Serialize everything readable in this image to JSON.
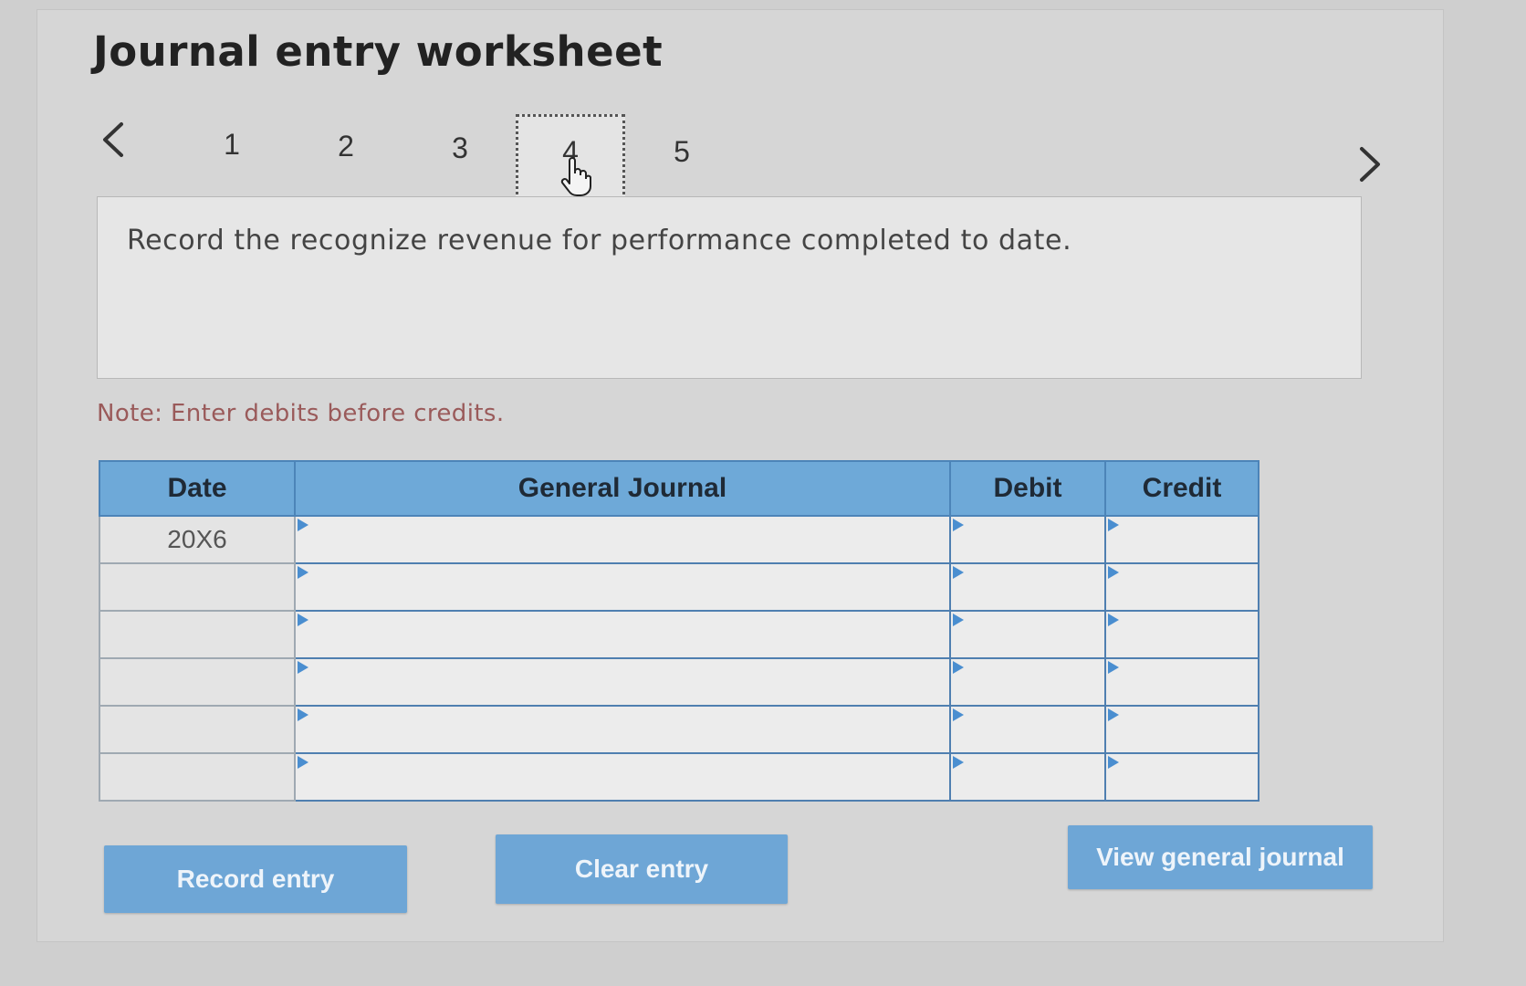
{
  "title": "Journal entry worksheet",
  "tabs": [
    "1",
    "2",
    "3",
    "4",
    "5"
  ],
  "active_tab": "4",
  "question": "Record the recognize revenue for performance completed to date.",
  "note": "Note: Enter debits before credits.",
  "table": {
    "headers": {
      "date": "Date",
      "general_journal": "General Journal",
      "debit": "Debit",
      "credit": "Credit"
    },
    "rows": [
      {
        "date": "20X6",
        "account": "",
        "debit": "",
        "credit": ""
      },
      {
        "date": "",
        "account": "",
        "debit": "",
        "credit": ""
      },
      {
        "date": "",
        "account": "",
        "debit": "",
        "credit": ""
      },
      {
        "date": "",
        "account": "",
        "debit": "",
        "credit": ""
      },
      {
        "date": "",
        "account": "",
        "debit": "",
        "credit": ""
      },
      {
        "date": "",
        "account": "",
        "debit": "",
        "credit": ""
      }
    ]
  },
  "buttons": {
    "record": "Record entry",
    "clear": "Clear entry",
    "view": "View general journal"
  },
  "icons": {
    "prev": "chevron-left-icon",
    "next": "chevron-right-icon",
    "cursor": "hand-pointer-icon"
  },
  "colors": {
    "header_blue": "#6ea9d8",
    "button_blue": "#6ea6d6",
    "note_text": "#9a5a5a"
  }
}
